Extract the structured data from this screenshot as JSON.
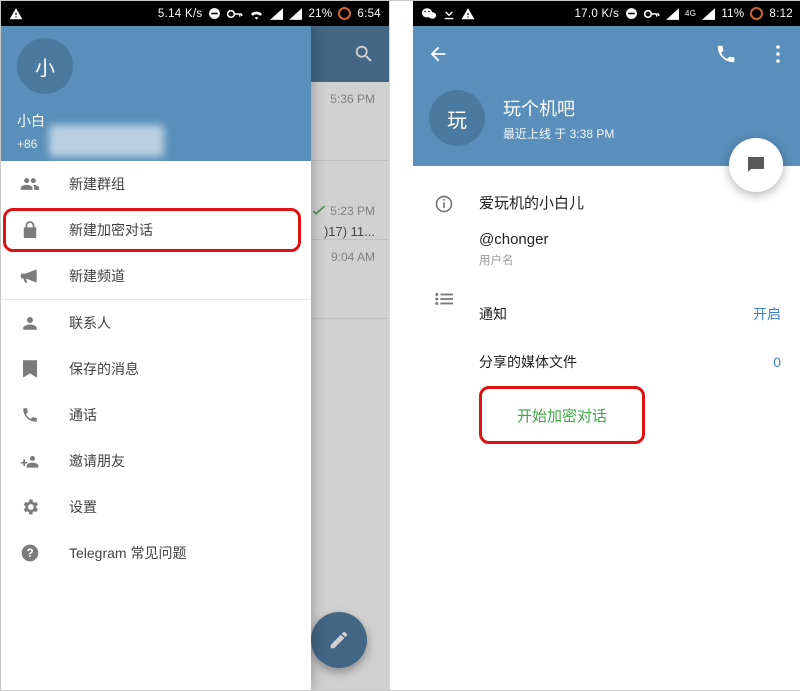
{
  "left": {
    "status": {
      "speed": "5.14 K/s",
      "battery": "21%",
      "time": "6:54"
    },
    "drawer": {
      "avatar_letter": "小",
      "username": "小白",
      "phone": "+86",
      "items": [
        {
          "icon": "group-icon",
          "label": "新建群组"
        },
        {
          "icon": "lock-icon",
          "label": "新建加密对话",
          "highlight": true
        },
        {
          "icon": "megaphone-icon",
          "label": "新建频道",
          "separator": true
        },
        {
          "icon": "contact-icon",
          "label": "联系人"
        },
        {
          "icon": "bookmark-icon",
          "label": "保存的消息"
        },
        {
          "icon": "phone-icon",
          "label": "通话"
        },
        {
          "icon": "invite-icon",
          "label": "邀请朋友"
        },
        {
          "icon": "settings-icon",
          "label": "设置"
        },
        {
          "icon": "help-icon",
          "label": "Telegram 常见问题"
        }
      ]
    },
    "behind": {
      "chats": [
        {
          "time": "5:36 PM"
        },
        {
          "time": "5:23 PM",
          "snippet": ")17) 11..."
        },
        {
          "time": "9:04 AM"
        }
      ]
    }
  },
  "right": {
    "status": {
      "speed": "17.0 K/s",
      "net": "4G",
      "battery": "11%",
      "time": "8:12"
    },
    "header": {
      "avatar_letter": "玩",
      "name": "玩个机吧",
      "last_seen": "最近上线 于 3:38 PM"
    },
    "profile": {
      "bio": "爱玩机的小白儿",
      "username": "@chonger",
      "username_caption": "用户名",
      "notif_label": "通知",
      "notif_value": "开启",
      "media_label": "分享的媒体文件",
      "media_value": "0",
      "secret_chat": "开始加密对话"
    }
  }
}
